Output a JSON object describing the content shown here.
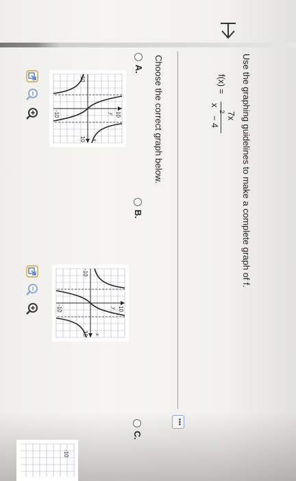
{
  "header": {
    "back_icon": "back-arrow-icon"
  },
  "question": {
    "instruction": "Use the graphing guidelines to make a complete graph of f.",
    "function_lhs": "f(x) =",
    "numerator": "7x",
    "denominator": "x",
    "exponent": "2",
    "denominator_rest": "− 4",
    "more_label": "•••"
  },
  "prompt": "Choose the correct graph below.",
  "options": [
    {
      "label": "A.",
      "tick_y_top": "10",
      "tick_x_right": "10",
      "tick_x_left": "-10",
      "tick_y_bottom": "-10",
      "axis_x": "x",
      "axis_y": "y"
    },
    {
      "label": "B.",
      "tick_y_top": "10",
      "tick_x_right": "10",
      "tick_x_left": "-10",
      "tick_y_bottom": "-10",
      "axis_x": "x",
      "axis_y": "y"
    },
    {
      "label": "C.",
      "tick_x_left": "-10"
    }
  ],
  "tools": {
    "zoom_in_icon": "zoom-in-icon",
    "zoom_out_icon": "zoom-out-icon",
    "popout_icon": "popout-icon"
  },
  "colors": {
    "accent": "#3b6fc2",
    "grid": "#aab3c0",
    "curve": "#2b2b2b"
  }
}
